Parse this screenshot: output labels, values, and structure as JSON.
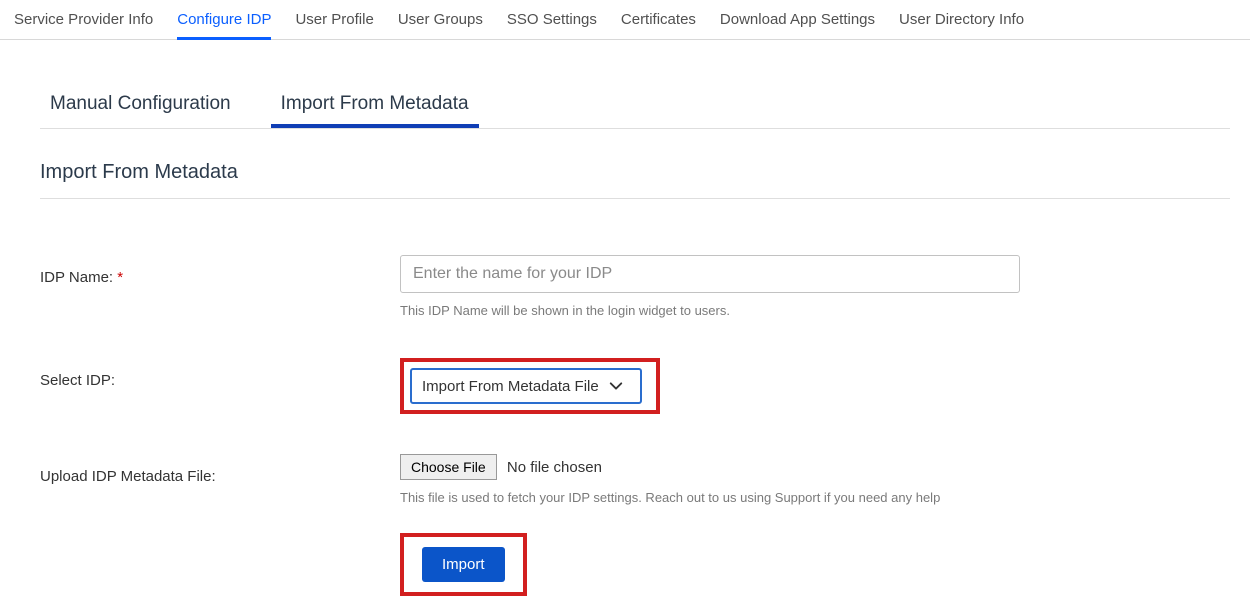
{
  "topTabs": {
    "t0": "Service Provider Info",
    "t1": "Configure IDP",
    "t2": "User Profile",
    "t3": "User Groups",
    "t4": "SSO Settings",
    "t5": "Certificates",
    "t6": "Download App Settings",
    "t7": "User Directory Info"
  },
  "subTabs": {
    "s0": "Manual Configuration",
    "s1": "Import From Metadata"
  },
  "section": {
    "title": "Import From Metadata"
  },
  "form": {
    "idpName": {
      "label": "IDP Name: ",
      "req": "*",
      "placeholder": "Enter the name for your IDP",
      "helper": "This IDP Name will be shown in the login widget to users."
    },
    "selectIdp": {
      "label": "Select IDP:",
      "value": "Import From Metadata File"
    },
    "upload": {
      "label": "Upload IDP Metadata File:",
      "button": "Choose File",
      "status": "No file chosen",
      "helper": "This file is used to fetch your IDP settings. Reach out to us using Support if you need any help"
    },
    "submit": {
      "label": "Import"
    }
  }
}
